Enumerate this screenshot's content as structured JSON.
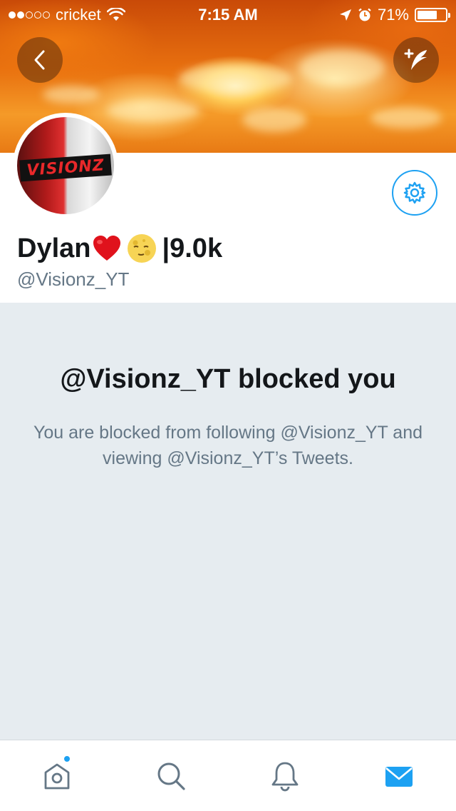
{
  "status_bar": {
    "carrier": "cricket",
    "time": "7:15 AM",
    "battery_percent": "71%",
    "battery_level": 0.71,
    "signal_bars_filled": 2,
    "signal_bars_total": 5
  },
  "profile": {
    "display_name_text": "Dylan",
    "display_name_suffix": "|9.0k",
    "handle": "@Visionz_YT",
    "avatar_logo_text": "VISIONZ"
  },
  "blocked": {
    "title": "@Visionz_YT blocked you",
    "body": "You are blocked from following @Visionz_YT and viewing @Visionz_YT’s Tweets."
  },
  "tabs": {
    "items": [
      "home-icon",
      "search-icon",
      "bell-icon",
      "mail-icon"
    ],
    "active": "mail-icon"
  },
  "colors": {
    "accent": "#1da1f2",
    "text_primary": "#14171a",
    "text_secondary": "#657786",
    "background": "#e6ecf0"
  }
}
